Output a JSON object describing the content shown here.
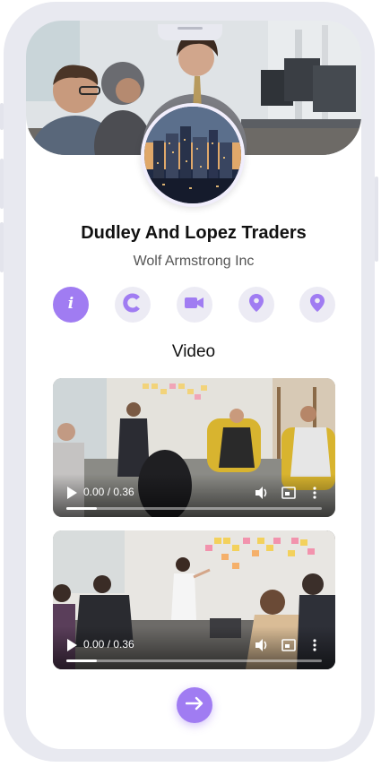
{
  "profile": {
    "name": "Dudley And Lopez Traders",
    "company": "Wolf Armstrong Inc",
    "cover_image": "office-people-working-photo",
    "avatar_image": "city-skyline-photo"
  },
  "actions": [
    {
      "id": "info",
      "icon": "info-icon",
      "active": true
    },
    {
      "id": "c",
      "icon": "c-brand-icon",
      "active": false
    },
    {
      "id": "video",
      "icon": "video-camera-icon",
      "active": false
    },
    {
      "id": "location1",
      "icon": "location-pin-icon",
      "active": false
    },
    {
      "id": "location2",
      "icon": "location-pin-icon",
      "active": false
    }
  ],
  "video_section": {
    "title": "Video",
    "videos": [
      {
        "scene": "team-meeting-photo",
        "time": "0.00 / 0.36",
        "progress": 0.12
      },
      {
        "scene": "sticky-notes-presentation-photo",
        "time": "0.00 / 0.36",
        "progress": 0.12
      }
    ]
  },
  "next_button": {
    "icon": "arrow-right-icon"
  },
  "colors": {
    "accent": "#a07cf2",
    "icon_bg": "#ecebf4",
    "frame": "#e8e9f0",
    "title": "#111111",
    "subtitle": "#555555"
  }
}
